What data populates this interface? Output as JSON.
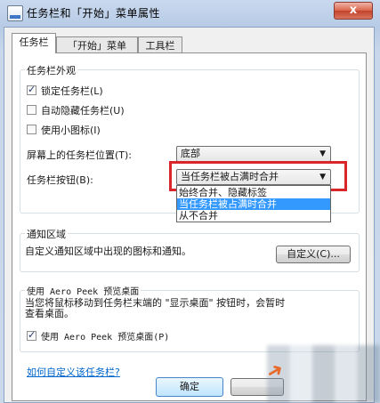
{
  "window": {
    "title": "任务栏和「开始」菜单属性",
    "close_label": "x"
  },
  "tabs": [
    {
      "label": "任务栏"
    },
    {
      "label": "「开始」菜单"
    },
    {
      "label": "工具栏"
    }
  ],
  "appearance": {
    "group_title": "任务栏外观",
    "lock": {
      "label": "锁定任务栏(L)",
      "checked": true
    },
    "autohide": {
      "label": "自动隐藏任务栏(U)",
      "checked": false
    },
    "small_icons": {
      "label": "使用小图标(I)",
      "checked": false
    },
    "position": {
      "label": "屏幕上的任务栏位置(T):",
      "value": "底部"
    },
    "buttons": {
      "label": "任务栏按钮(B):",
      "value": "当任务栏被占满时合并",
      "options": [
        "始终合并、隐藏标签",
        "当任务栏被占满时合并",
        "从不合并"
      ]
    }
  },
  "notification": {
    "group_title": "通知区域",
    "desc": "自定义通知区域中出现的图标和通知。",
    "customize_label": "自定义(C)..."
  },
  "aero_peek": {
    "group_title": "使用 Aero Peek 预览桌面",
    "desc_line1": "当您将鼠标移动到任务栏末端的 \"显示桌面\" 按钮时，会暂时",
    "desc_line2": "查看桌面。",
    "checkbox_label": "使用 Aero Peek 预览桌面(P)",
    "checked": true
  },
  "link": "如何自定义该任务栏?",
  "footer": {
    "ok_label": "确定"
  }
}
